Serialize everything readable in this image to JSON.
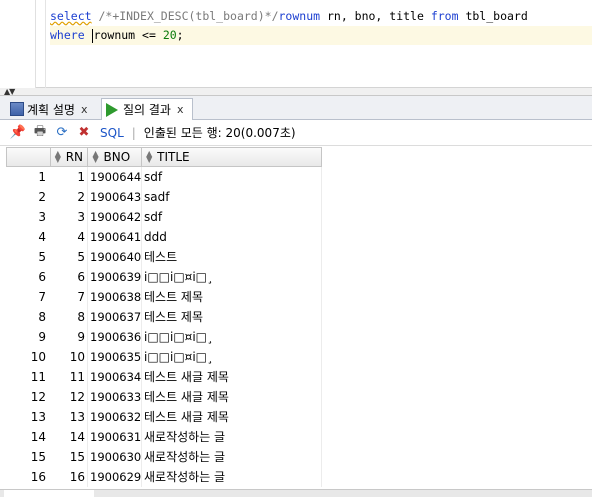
{
  "editor": {
    "line1": {
      "kw_select": "select",
      "comment": "/*+INDEX_DESC(tbl_board)*/",
      "kw_rownum": "rownum",
      "rest1": " rn, bno, title ",
      "kw_from": "from",
      "rest2": " tbl_board"
    },
    "line2": {
      "kw_where": "where",
      "rownum": "rownum",
      "op": " <= ",
      "num": "20",
      "end": ";"
    }
  },
  "tabs": {
    "plan_label": "계획 설명",
    "result_label": "질의 결과",
    "close": "x"
  },
  "toolbar": {
    "sql_label": "SQL",
    "separator": "|",
    "status": "인출된 모든 행: 20(0.007초)"
  },
  "grid": {
    "headers": [
      "RN",
      "BNO",
      "TITLE"
    ],
    "rows": [
      {
        "idx": "1",
        "rn": "1",
        "bno": "1900644",
        "title": "sdf"
      },
      {
        "idx": "2",
        "rn": "2",
        "bno": "1900643",
        "title": "sadf"
      },
      {
        "idx": "3",
        "rn": "3",
        "bno": "1900642",
        "title": "sdf"
      },
      {
        "idx": "4",
        "rn": "4",
        "bno": "1900641",
        "title": "ddd"
      },
      {
        "idx": "5",
        "rn": "5",
        "bno": "1900640",
        "title": "테스트"
      },
      {
        "idx": "6",
        "rn": "6",
        "bno": "1900639",
        "title": "i□□i□¤i□¸"
      },
      {
        "idx": "7",
        "rn": "7",
        "bno": "1900638",
        "title": "테스트 제목"
      },
      {
        "idx": "8",
        "rn": "8",
        "bno": "1900637",
        "title": "테스트 제목"
      },
      {
        "idx": "9",
        "rn": "9",
        "bno": "1900636",
        "title": "i□□i□¤i□¸"
      },
      {
        "idx": "10",
        "rn": "10",
        "bno": "1900635",
        "title": "i□□i□¤i□¸"
      },
      {
        "idx": "11",
        "rn": "11",
        "bno": "1900634",
        "title": "테스트 새글 제목"
      },
      {
        "idx": "12",
        "rn": "12",
        "bno": "1900633",
        "title": "테스트 새글 제목"
      },
      {
        "idx": "13",
        "rn": "13",
        "bno": "1900632",
        "title": "테스트 새글 제목"
      },
      {
        "idx": "14",
        "rn": "14",
        "bno": "1900631",
        "title": "새로작성하는 글"
      },
      {
        "idx": "15",
        "rn": "15",
        "bno": "1900630",
        "title": "새로작성하는 글"
      },
      {
        "idx": "16",
        "rn": "16",
        "bno": "1900629",
        "title": "새로작성하는 글"
      }
    ]
  },
  "icons": {
    "pin": "pin-icon",
    "print": "print-icon",
    "refresh": "refresh-icon",
    "export": "export-icon",
    "plan": "explain-plan-icon",
    "run": "run-query-icon"
  }
}
